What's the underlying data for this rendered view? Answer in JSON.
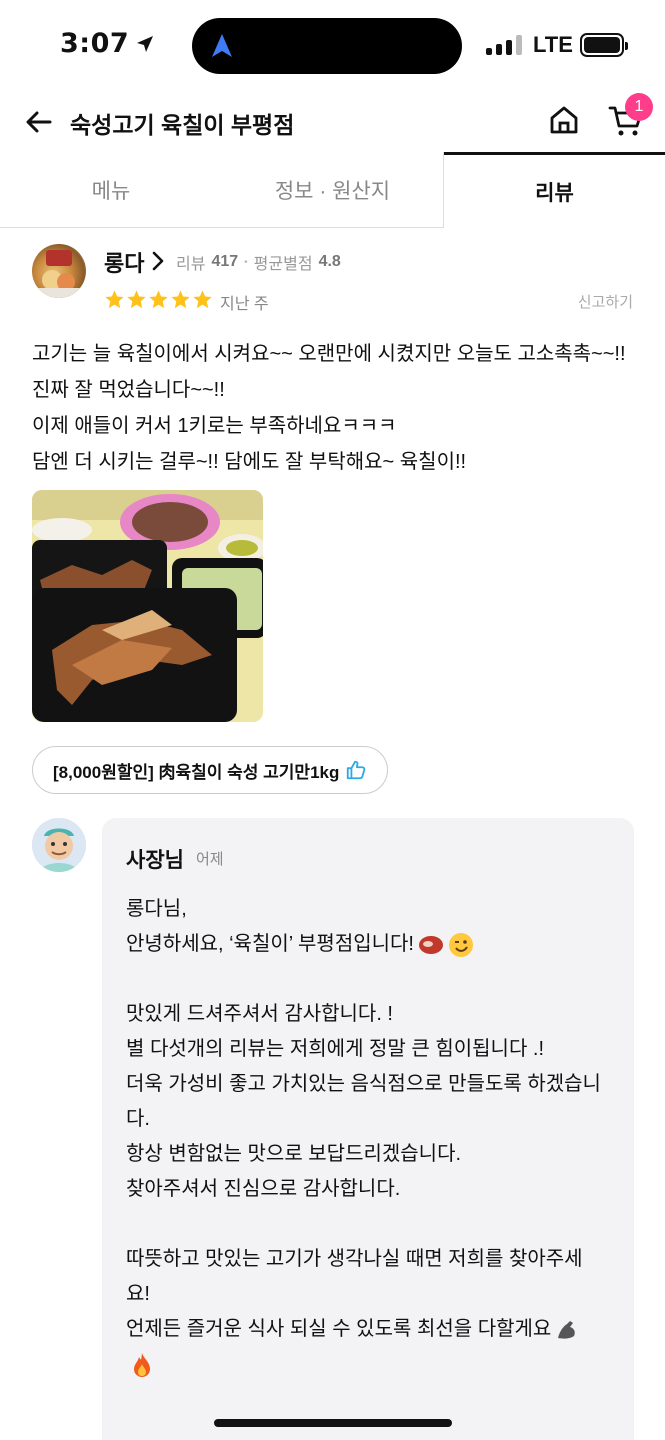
{
  "status_bar": {
    "time": "3:07",
    "network": "LTE"
  },
  "header": {
    "title": "숙성고기 육칠이 부평점",
    "cart_count": "1"
  },
  "tabs": [
    {
      "label": "메뉴"
    },
    {
      "label": "정보 · 원산지"
    },
    {
      "label": "리뷰"
    }
  ],
  "review": {
    "reviewer": "롱다",
    "review_count_label": "리뷰",
    "review_count": "417",
    "separator": "•",
    "avg_rating_label": "평균별점",
    "avg_rating": "4.8",
    "stars": 5,
    "date": "지난 주",
    "report_label": "신고하기",
    "text": "고기는 늘 육칠이에서 시켜요~~ 오랜만에 시켰지만 오늘도 고소촉촉~~!! 진짜 잘 먹었습니다~~!!\n이제 애들이 커서 1키로는 부족하네요ㅋㅋㅋ\n담엔 더 시키는 걸루~!! 담에도 잘 부탁해요~ 육칠이!!",
    "menu_item": "[8,000원할인] 肉육칠이 숙성 고기만1kg"
  },
  "reply": {
    "owner_name": "사장님",
    "date": "어제",
    "paragraphs": [
      "롱다님,\n안녕하세요, ‘육칠이’ 부평점입니다!",
      "맛있게 드셔주셔서 감사합니다. !\n별 다섯개의 리뷰는 저희에게 정말 큰 힘이됩니다 .!\n더욱 가성비 좋고 가치있는 음식점으로 만들도록 하겠습니다.\n항상 변함없는 맛으로 보답드리겠습니다.\n찾아주셔서 진심으로 감사합니다.",
      "따뜻하고 맛있는 고기가 생각나실 때면 저희를 찾아주세요!\n언제든 즐거운 식사 되실 수 있도록 최선을 다할게요"
    ]
  },
  "colors": {
    "star": "#ffc21a",
    "badge": "#ff3d8b",
    "thumb": "#2fa8e8",
    "tab_active": "#111111"
  },
  "icons": [
    "back-arrow-icon",
    "home-icon",
    "cart-icon",
    "chevron-right-icon",
    "star-icon",
    "thumbs-up-icon",
    "location-arrow-icon"
  ]
}
